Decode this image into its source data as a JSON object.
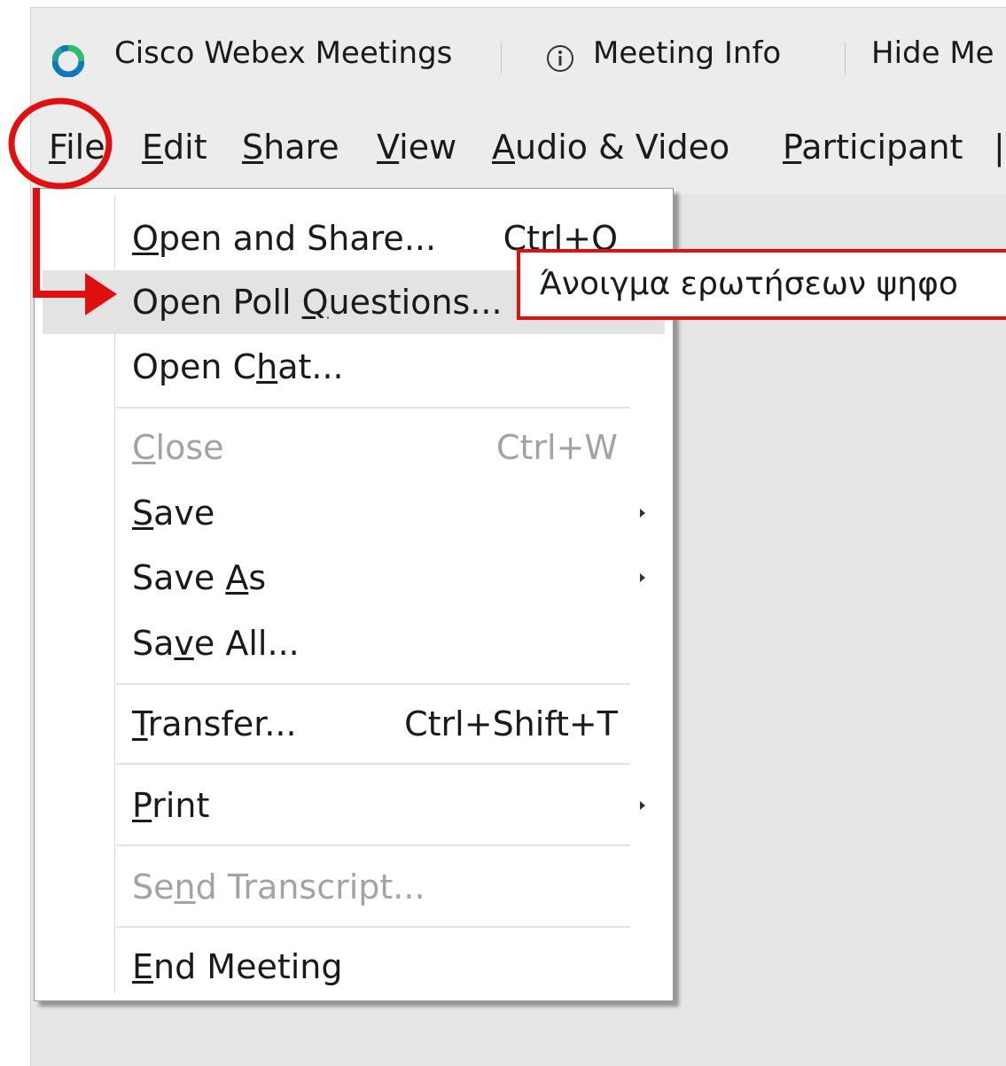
{
  "titlebar": {
    "app_name": "Cisco Webex Meetings",
    "meeting_info": "Meeting Info",
    "hide_menu": "Hide Me"
  },
  "menubar": {
    "items": [
      {
        "label": "File",
        "mnemonic": "F"
      },
      {
        "label": "Edit",
        "mnemonic": "E"
      },
      {
        "label": "Share",
        "mnemonic": "S"
      },
      {
        "label": "View",
        "mnemonic": "V"
      },
      {
        "label": "Audio & Video",
        "mnemonic": "A"
      },
      {
        "label": "Participant",
        "mnemonic": "P"
      }
    ]
  },
  "file_menu": {
    "items": [
      {
        "label": "Open and Share...",
        "shortcut": "Ctrl+O",
        "enabled": true
      },
      {
        "label": "Open Poll Questions...",
        "shortcut": "",
        "enabled": true,
        "highlighted": true
      },
      {
        "label": "Open Chat...",
        "shortcut": "",
        "enabled": true
      },
      {
        "label": "Close",
        "shortcut": "Ctrl+W",
        "enabled": false
      },
      {
        "label": "Save",
        "shortcut": "",
        "enabled": true,
        "submenu": true
      },
      {
        "label": "Save As",
        "shortcut": "",
        "enabled": true,
        "submenu": true
      },
      {
        "label": "Save All...",
        "shortcut": "",
        "enabled": true
      },
      {
        "label": "Transfer...",
        "shortcut": "Ctrl+Shift+T",
        "enabled": true
      },
      {
        "label": "Print",
        "shortcut": "",
        "enabled": true,
        "submenu": true
      },
      {
        "label": "Send Transcript...",
        "shortcut": "",
        "enabled": false
      },
      {
        "label": "End Meeting",
        "shortcut": "",
        "enabled": true
      }
    ]
  },
  "annotation": {
    "tooltip_text": "Άνοιγμα ερωτήσεων  ψηφο",
    "color": "#e01010"
  },
  "colors": {
    "webex_ring_outer": "#0a7ab8",
    "webex_ring_inner": "#2dbd6e"
  }
}
